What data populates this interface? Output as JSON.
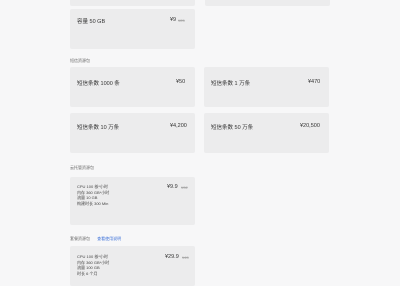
{
  "storage": {
    "label": "容量 50 GB",
    "price": "¥9",
    "original": "¥25"
  },
  "sms_section": {
    "title": "短信资源包"
  },
  "sms_items": [
    {
      "label": "短信条数 1000 条",
      "price": "¥50"
    },
    {
      "label": "短信条数 1 万条",
      "price": "¥470"
    },
    {
      "label": "短信条数 10 万条",
      "price": "¥4,200"
    },
    {
      "label": "短信条数 50 万条",
      "price": "¥20,500"
    }
  ],
  "cloud_section": {
    "title": "云托管资源包"
  },
  "cloud_item": {
    "specs": [
      "CPU 100 核*小时",
      "内存 360 GB*小时",
      "流量 10 GB",
      "构建时长 300 Min"
    ],
    "price": "¥9.9",
    "original": "¥32"
  },
  "pkg_section": {
    "title": "套餐资源包",
    "link": "查看使用说明"
  },
  "pkg_item": {
    "specs": [
      "CPU 100 核*小时",
      "内存 360 GB*小时",
      "流量 100 GB",
      "时长 6 个月"
    ],
    "price": "¥29.9",
    "original": "¥45"
  },
  "colors": {
    "card_bg": "#ececed",
    "page_bg": "#f7f7f8",
    "link": "#3a6fd8"
  }
}
